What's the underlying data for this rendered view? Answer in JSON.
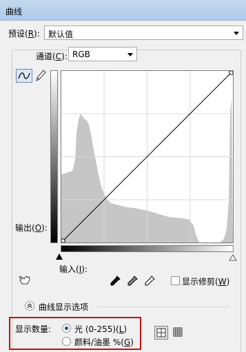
{
  "window": {
    "title": "曲线"
  },
  "preset": {
    "label": "预设(",
    "key": "R",
    "suffix": "):",
    "value": "默认值"
  },
  "channel": {
    "label": "通道(",
    "key": "C",
    "suffix": "):",
    "value": "RGB"
  },
  "output": {
    "label": "输出(",
    "key": "O",
    "suffix": "):"
  },
  "input": {
    "label": "输入(",
    "key": "I",
    "suffix": "):"
  },
  "show_clipping": {
    "label": "显示修剪(",
    "key": "W",
    "suffix": ")",
    "checked": false
  },
  "curve_options": {
    "label": "曲线显示选项"
  },
  "show_amount": {
    "label": "显示数量:",
    "light": {
      "label": "光 (0-255)(",
      "key": "L",
      "suffix": ")",
      "selected": true
    },
    "pigment": {
      "label": "颜料/油墨 %(",
      "key": "G",
      "suffix": ")",
      "selected": false
    }
  },
  "icons": [
    "curve-tool-icon",
    "pencil-icon",
    "hand-adjust-icon",
    "black-eyedropper-icon",
    "gray-eyedropper-icon",
    "white-eyedropper-icon",
    "grid-4-icon",
    "grid-10-icon",
    "chevron-up-icon",
    "dropdown-arrow-icon"
  ],
  "colors": {
    "highlight_border": "#c01010",
    "histogram": "#c6c6c6",
    "grid": "#d8d8d8"
  }
}
